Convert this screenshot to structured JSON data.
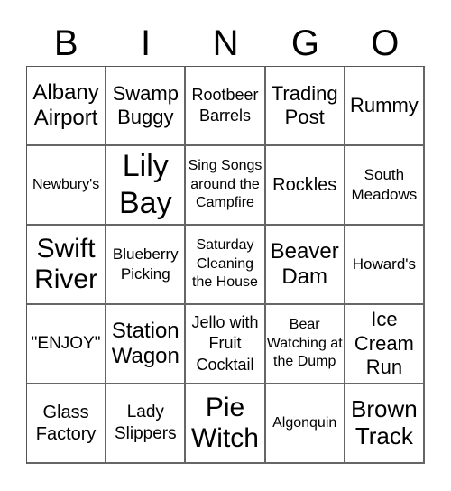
{
  "header": {
    "letters": [
      "B",
      "I",
      "N",
      "G",
      "O"
    ]
  },
  "card": {
    "rows": [
      [
        "Albany Airport",
        "Swamp Buggy",
        "Rootbeer Barrels",
        "Trading Post",
        "Rummy"
      ],
      [
        "Newbury's",
        "Lily Bay",
        "Sing Songs around the Campfire",
        "Rockles",
        "South Meadows"
      ],
      [
        "Swift River",
        "Blueberry Picking",
        "Saturday Cleaning the House",
        "Beaver Dam",
        "Howard's"
      ],
      [
        "\"ENJOY\"",
        "Station Wagon",
        "Jello with Fruit Cocktail",
        "Bear Watching at the Dump",
        "Ice Cream Run"
      ],
      [
        "Glass Factory",
        "Lady Slippers",
        "Pie Witch",
        "Algonquin",
        "Brown Track"
      ]
    ]
  }
}
